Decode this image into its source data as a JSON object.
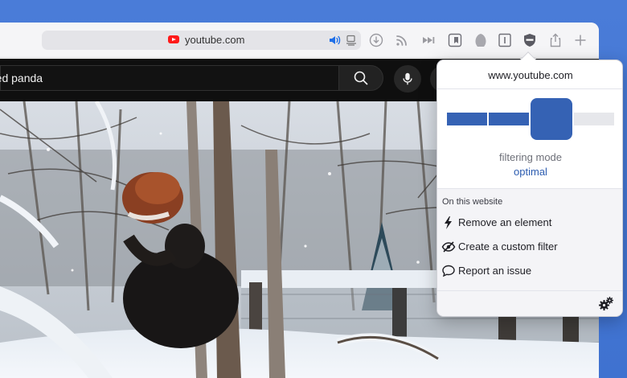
{
  "browser": {
    "url_host": "youtube.com",
    "icons": [
      "youtube-favicon",
      "audio-icon",
      "reader-icon",
      "download-icon",
      "rss-icon",
      "forward-icon",
      "sidebar-bookmark-icon",
      "hand-icon",
      "info-icon",
      "ublock-shield-icon",
      "share-icon",
      "new-tab-icon"
    ]
  },
  "youtube": {
    "search_value": "red panda"
  },
  "popup": {
    "domain": "www.youtube.com",
    "filtering_mode_label": "filtering mode",
    "filtering_mode_value": "optimal",
    "filtering_level": 3,
    "filtering_levels_total": 4,
    "section_title": "On this website",
    "actions": [
      {
        "label": "Remove an element",
        "icon": "lightning-icon"
      },
      {
        "label": "Create a custom filter",
        "icon": "eye-slash-icon"
      },
      {
        "label": "Report an issue",
        "icon": "speech-bubble-icon"
      }
    ],
    "settings_icon": "gears-icon",
    "colors": {
      "accent": "#3562b4",
      "accent_light": "#2c5cb0",
      "inactive": "#e6e7eb"
    }
  }
}
